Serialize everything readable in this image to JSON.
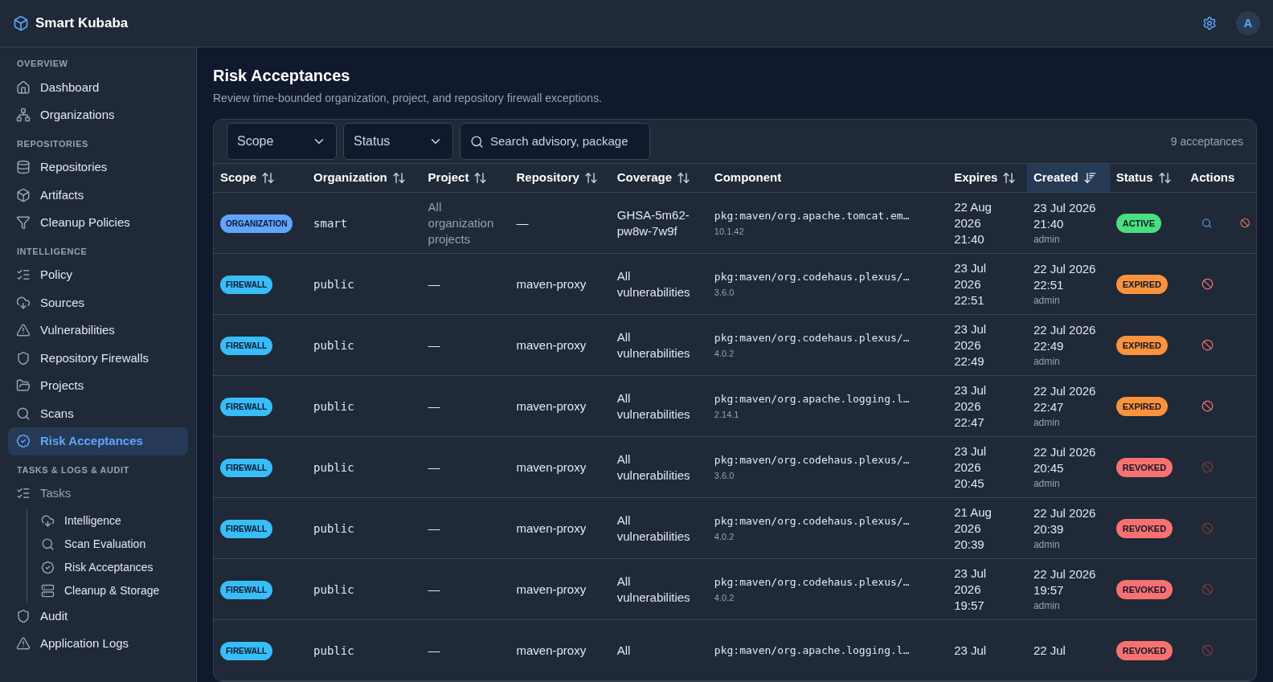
{
  "app": {
    "name": "Smart Kubaba",
    "avatar": "A"
  },
  "sidebar": {
    "sections": [
      {
        "title": "OVERVIEW",
        "items": [
          {
            "label": "Dashboard",
            "selected": false
          },
          {
            "label": "Organizations",
            "selected": false
          }
        ]
      },
      {
        "title": "REPOSITORIES",
        "items": [
          {
            "label": "Repositories",
            "selected": false
          },
          {
            "label": "Artifacts",
            "selected": false
          },
          {
            "label": "Cleanup Policies",
            "selected": false
          }
        ]
      },
      {
        "title": "INTELLIGENCE",
        "items": [
          {
            "label": "Policy",
            "selected": false
          },
          {
            "label": "Sources",
            "selected": false
          },
          {
            "label": "Vulnerabilities",
            "selected": false
          },
          {
            "label": "Repository Firewalls",
            "selected": false
          },
          {
            "label": "Projects",
            "selected": false
          },
          {
            "label": "Scans",
            "selected": false
          },
          {
            "label": "Risk Acceptances",
            "selected": true
          }
        ]
      },
      {
        "title": "TASKS & LOGS & AUDIT",
        "items": [
          {
            "label": "Tasks",
            "selected": false,
            "expanded": true,
            "children": [
              {
                "label": "Intelligence",
                "selected": false
              },
              {
                "label": "Scan Evaluation",
                "selected": false
              },
              {
                "label": "Risk Acceptances",
                "selected": false
              },
              {
                "label": "Cleanup & Storage",
                "selected": false
              }
            ]
          },
          {
            "label": "Audit",
            "selected": false
          },
          {
            "label": "Application Logs",
            "selected": false
          }
        ]
      }
    ]
  },
  "page": {
    "title": "Risk Acceptances",
    "subtitle": "Review time-bounded organization, project, and repository firewall exceptions."
  },
  "filters": {
    "scope": "Scope",
    "status": "Status",
    "search_placeholder": "Search advisory, package",
    "count": "9 acceptances"
  },
  "table": {
    "columns": [
      {
        "label": "Scope",
        "sortable": true,
        "sorted": false
      },
      {
        "label": "Organization",
        "sortable": true,
        "sorted": false
      },
      {
        "label": "Project",
        "sortable": true,
        "sorted": false
      },
      {
        "label": "Repository",
        "sortable": true,
        "sorted": false
      },
      {
        "label": "Coverage",
        "sortable": true,
        "sorted": false
      },
      {
        "label": "Component",
        "sortable": false,
        "sorted": false
      },
      {
        "label": "Expires",
        "sortable": true,
        "sorted": false
      },
      {
        "label": "Created",
        "sortable": true,
        "sorted": true
      },
      {
        "label": "Status",
        "sortable": true,
        "sorted": false
      },
      {
        "label": "Actions",
        "sortable": false,
        "sorted": false
      }
    ],
    "rows": [
      {
        "scope": {
          "label": "ORGANIZATION",
          "color": "#60a5fa"
        },
        "organization": "smart",
        "project": "All organization projects",
        "project_muted": true,
        "repository": "—",
        "coverage": "GHSA-5m62-pw8w-7w9f",
        "component": "pkg:maven/org.apache.tomcat.em…",
        "version": "10.1.42",
        "expires": "22 Aug 2026 21:40",
        "created": "23 Jul 2026 21:40",
        "created_by": "admin",
        "status": {
          "label": "ACTIVE",
          "color": "#4ade80"
        },
        "actions": [
          {
            "kind": "view",
            "disabled": false
          },
          {
            "kind": "revoke",
            "disabled": false
          }
        ]
      },
      {
        "scope": {
          "label": "FIREWALL",
          "color": "#38bdf8"
        },
        "organization": "public",
        "project": "—",
        "project_muted": false,
        "repository": "maven-proxy",
        "coverage": "All vulnerabilities",
        "component": "pkg:maven/org.codehaus.plexus/…",
        "version": "3.6.0",
        "expires": "23 Jul 2026 22:51",
        "created": "22 Jul 2026 22:51",
        "created_by": "admin",
        "status": {
          "label": "EXPIRED",
          "color": "#fb923c"
        },
        "actions": [
          {
            "kind": "revoke",
            "disabled": false
          }
        ]
      },
      {
        "scope": {
          "label": "FIREWALL",
          "color": "#38bdf8"
        },
        "organization": "public",
        "project": "—",
        "project_muted": false,
        "repository": "maven-proxy",
        "coverage": "All vulnerabilities",
        "component": "pkg:maven/org.codehaus.plexus/…",
        "version": "4.0.2",
        "expires": "23 Jul 2026 22:49",
        "created": "22 Jul 2026 22:49",
        "created_by": "admin",
        "status": {
          "label": "EXPIRED",
          "color": "#fb923c"
        },
        "actions": [
          {
            "kind": "revoke",
            "disabled": false
          }
        ]
      },
      {
        "scope": {
          "label": "FIREWALL",
          "color": "#38bdf8"
        },
        "organization": "public",
        "project": "—",
        "project_muted": false,
        "repository": "maven-proxy",
        "coverage": "All vulnerabilities",
        "component": "pkg:maven/org.apache.logging.l…",
        "version": "2.14.1",
        "expires": "23 Jul 2026 22:47",
        "created": "22 Jul 2026 22:47",
        "created_by": "admin",
        "status": {
          "label": "EXPIRED",
          "color": "#fb923c"
        },
        "actions": [
          {
            "kind": "revoke",
            "disabled": false
          }
        ]
      },
      {
        "scope": {
          "label": "FIREWALL",
          "color": "#38bdf8"
        },
        "organization": "public",
        "project": "—",
        "project_muted": false,
        "repository": "maven-proxy",
        "coverage": "All vulnerabilities",
        "component": "pkg:maven/org.codehaus.plexus/…",
        "version": "3.6.0",
        "expires": "23 Jul 2026 20:45",
        "created": "22 Jul 2026 20:45",
        "created_by": "admin",
        "status": {
          "label": "REVOKED",
          "color": "#f87171"
        },
        "actions": [
          {
            "kind": "revoke",
            "disabled": true
          }
        ]
      },
      {
        "scope": {
          "label": "FIREWALL",
          "color": "#38bdf8"
        },
        "organization": "public",
        "project": "—",
        "project_muted": false,
        "repository": "maven-proxy",
        "coverage": "All vulnerabilities",
        "component": "pkg:maven/org.codehaus.plexus/…",
        "version": "4.0.2",
        "expires": "21 Aug 2026 20:39",
        "created": "22 Jul 2026 20:39",
        "created_by": "admin",
        "status": {
          "label": "REVOKED",
          "color": "#f87171"
        },
        "actions": [
          {
            "kind": "revoke",
            "disabled": true
          }
        ]
      },
      {
        "scope": {
          "label": "FIREWALL",
          "color": "#38bdf8"
        },
        "organization": "public",
        "project": "—",
        "project_muted": false,
        "repository": "maven-proxy",
        "coverage": "All vulnerabilities",
        "component": "pkg:maven/org.codehaus.plexus/…",
        "version": "4.0.2",
        "expires": "23 Jul 2026 19:57",
        "created": "22 Jul 2026 19:57",
        "created_by": "admin",
        "status": {
          "label": "REVOKED",
          "color": "#f87171"
        },
        "actions": [
          {
            "kind": "revoke",
            "disabled": true
          }
        ]
      },
      {
        "scope": {
          "label": "FIREWALL",
          "color": "#38bdf8"
        },
        "organization": "public",
        "project": "—",
        "project_muted": false,
        "repository": "maven-proxy",
        "coverage": "All",
        "component": "pkg:maven/org.apache.logging.l…",
        "expires": "23 Jul",
        "created": "22 Jul",
        "status": {
          "label": "REVOKED",
          "color": "#f87171"
        },
        "actions": [
          {
            "kind": "revoke",
            "disabled": true
          }
        ]
      }
    ]
  }
}
